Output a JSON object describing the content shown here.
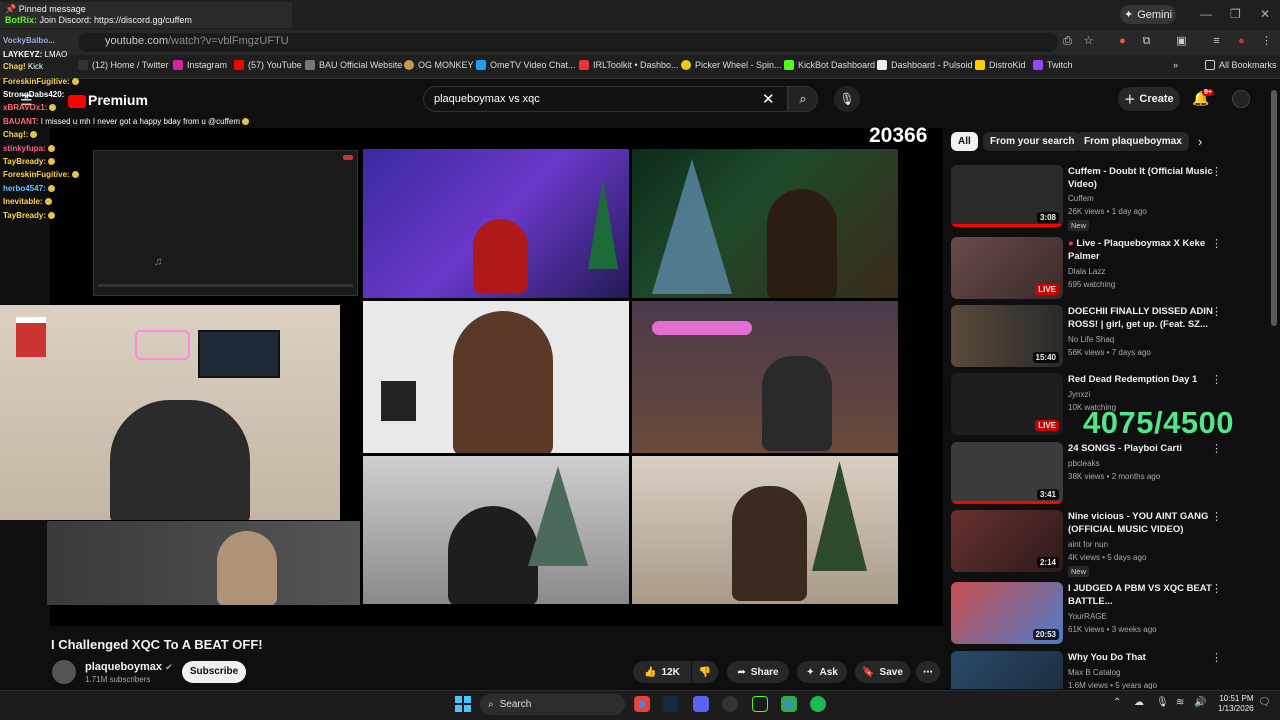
{
  "browser": {
    "url_host": "youtube.com",
    "url_path": "/watch?v=vblFmgzUFTU",
    "gemini_label": "Gemini",
    "bookmarks": [
      {
        "label": "(12) Home / Twitter",
        "color": "#333"
      },
      {
        "label": "Instagram",
        "color": "#d6249f"
      },
      {
        "label": "(57) YouTube",
        "color": "#ff0000"
      },
      {
        "label": "BAU Official Website",
        "color": "#777"
      },
      {
        "label": "OG MONKEY",
        "color": "#c59b4b"
      },
      {
        "label": "OmeTV Video Chat...",
        "color": "#1da1f2"
      },
      {
        "label": "IRLToolkit • Dashbo...",
        "color": "#e33"
      },
      {
        "label": "Picker Wheel - Spin...",
        "color": "#f5c518"
      },
      {
        "label": "KickBot Dashboard",
        "color": "#53fc18"
      },
      {
        "label": "Dashboard - Pulsoid",
        "color": "#eee"
      },
      {
        "label": "DistroKid",
        "color": "#ffcc00"
      },
      {
        "label": "Twitch",
        "color": "#9146ff"
      }
    ],
    "all_bookmarks": "All Bookmarks"
  },
  "chat": {
    "pinned_title": "Pinned message",
    "pinned_user": "BotRix:",
    "pinned_text": "Join Discord: https://discord.gg/cuffem",
    "lines": [
      {
        "user": "VockyBalbo...",
        "text": "",
        "color": "#9ad"
      },
      {
        "user": "Chag!",
        "text": "Kick",
        "color": "#ffd34d"
      },
      {
        "user": "LAYKEYZ:",
        "text": "LMAO",
        "color": "#fff"
      },
      {
        "user": "ForeskinFugitive:",
        "text": "",
        "color": "#ffd34d"
      },
      {
        "user": "StrongDabs420:",
        "text": "",
        "color": "#fff"
      },
      {
        "user": "xBRAVOx1:",
        "text": "",
        "color": "#ff6b6b"
      },
      {
        "user": "BAUANT:",
        "text": "I missed u mh I never got a happy bday from u @cuffem",
        "color": "#ff6b6b"
      },
      {
        "user": "stinkyfupa:",
        "text": "",
        "color": "#ff5c8a"
      },
      {
        "user": "Chag!:",
        "text": "",
        "color": "#ffd34d"
      },
      {
        "user": "TayBready:",
        "text": "",
        "color": "#ffd34d"
      },
      {
        "user": "ForeskinFugitive:",
        "text": "",
        "color": "#ffd34d"
      },
      {
        "user": "herbo4547:",
        "text": "",
        "color": "#67c1ff"
      },
      {
        "user": "Inevitable:",
        "text": "",
        "color": "#ffd34d"
      },
      {
        "user": "TayBready:",
        "text": "",
        "color": "#ffd34d"
      }
    ]
  },
  "youtube": {
    "logo": "Premium",
    "search_query": "plaqueboymax vs xqc",
    "create_label": "Create",
    "notif_badge": "9+"
  },
  "overlay": {
    "counter": "20366",
    "goal": "4075/4500"
  },
  "video": {
    "title": "I Challenged XQC To A BEAT OFF!",
    "channel": "plaqueboymax",
    "subscribers": "1.71M subscribers",
    "subscribe_label": "Subscribe",
    "likes": "12K",
    "share_label": "Share",
    "ask_label": "Ask",
    "save_label": "Save"
  },
  "chips": [
    "All",
    "From your search",
    "From plaqueboymax"
  ],
  "recommendations": [
    {
      "title": "Cuffem - Doubt It (Official Music Video)",
      "channel": "Cuffem",
      "stats": "26K views • 1 day ago",
      "badge": "3:08",
      "new": "New",
      "thumb": "#2a2a2a"
    },
    {
      "title": "Live - Plaqueboymax X Keke Palmer",
      "channel": "Dlala Lazz",
      "stats": "695 watching",
      "badge": "LIVE",
      "new": "",
      "thumb": "#5a3a3a"
    },
    {
      "title": "DOECHII FINALLY DISSED ADIN ROSS! | girl, get up. (Feat. SZ...",
      "channel": "No Life Shaq",
      "stats": "56K views • 7 days ago",
      "badge": "15:40",
      "new": "",
      "thumb": "#3a2a22"
    },
    {
      "title": "Red Dead Redemption Day 1",
      "channel": "Jynxzi",
      "stats": "10K watching",
      "badge": "LIVE",
      "new": "",
      "thumb": "#1d1d1d"
    },
    {
      "title": "24 SONGS - Playboi Carti",
      "channel": "pbcleaks",
      "stats": "38K views • 2 months ago",
      "badge": "3:41",
      "new": "",
      "thumb": "#3b3b3b"
    },
    {
      "title": "Nine vicious - YOU AINT GANG (OFFICIAL MUSIC VIDEO)",
      "channel": "aint for nun",
      "stats": "4K views • 5 days ago",
      "badge": "2:14",
      "new": "New",
      "thumb": "#4a3030"
    },
    {
      "title": "I JUDGED A PBM VS XQC BEAT BATTLE...",
      "channel": "YourRAGE",
      "stats": "61K views • 3 weeks ago",
      "badge": "20:53",
      "new": "",
      "thumb": "#c94d4d"
    },
    {
      "title": "Why You Do That",
      "channel": "Max B Catalog",
      "stats": "1.6M views • 5 years ago",
      "badge": "",
      "new": "",
      "thumb": "#2a4a6a"
    }
  ],
  "taskbar": {
    "search_label": "Search",
    "time": "10:51 PM",
    "date": "1/13/2026"
  }
}
